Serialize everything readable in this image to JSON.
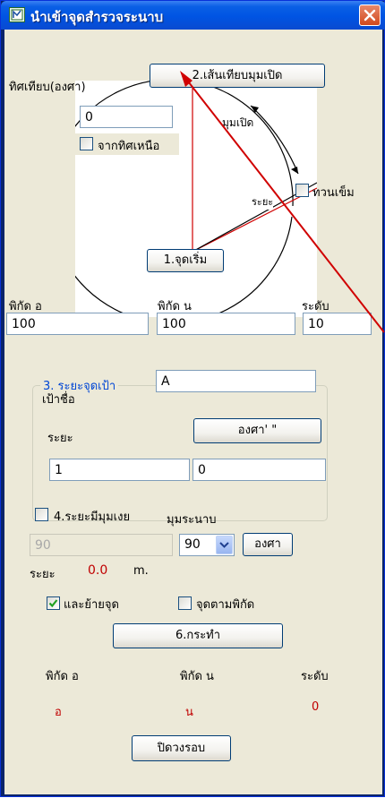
{
  "window": {
    "title": "นำเข้าจุดสำรวจระนาบ",
    "icon": "survey-app-icon",
    "close_icon": "close-icon"
  },
  "direction": {
    "label": "ทิศเทียบ(องศา)",
    "angle_value": "0",
    "from_north_label": "จากทิศเหนือ",
    "from_north_checked": false
  },
  "buttons": {
    "open_angle_line": "2.เส้นเทียบมุมเปิด",
    "start_point": "1.จุดเริ่ม",
    "degree_minute_second": "องศา' \"",
    "degree": "องศา",
    "execute": "6.กระทำ",
    "close_loop": "ปิดวงรอบ"
  },
  "diagram": {
    "open_angle_label": "มุมเปิด",
    "distance_label": "ระยะ",
    "counter_clockwise_label": "ทวนเข็ม",
    "counter_clockwise_checked": false
  },
  "coordinates": {
    "e_label": "พิกัด อ",
    "e_value": "100",
    "n_label": "พิกัด น",
    "n_value": "100",
    "level_label": "ระดับ",
    "level_value": "10"
  },
  "target": {
    "group_title": "3. ระยะจุดเป้า",
    "name_label": "เป้าชื่อ",
    "name_value": "A",
    "distance_label": "ระยะ",
    "distance_value": "1",
    "second_value": "0"
  },
  "slope": {
    "label": "4.ระยะมีมุมเงย",
    "checked": false,
    "plane_angle_label": "มุมระนาบ",
    "slope_value": "90",
    "angle_select_value": "90",
    "horizontal_distance_label": "ระยะ",
    "horizontal_distance_value": "0.0",
    "unit": "m."
  },
  "options": {
    "move_point_label": "และย้ายจุด",
    "move_point_checked": true,
    "point_by_coord_label": "จุดตามพิกัด",
    "point_by_coord_checked": false
  },
  "result": {
    "e_label": "พิกัด อ",
    "n_label": "พิกัด น",
    "level_label": "ระดับ",
    "e_value": "อ",
    "n_value": "น",
    "level_value": "0"
  },
  "colors": {
    "title_bar": "#0054e3",
    "dialog_bg": "#ece9d8",
    "result_red": "#c00000",
    "annotation_arrow": "#d00000",
    "group_title_blue": "#0046d5"
  }
}
